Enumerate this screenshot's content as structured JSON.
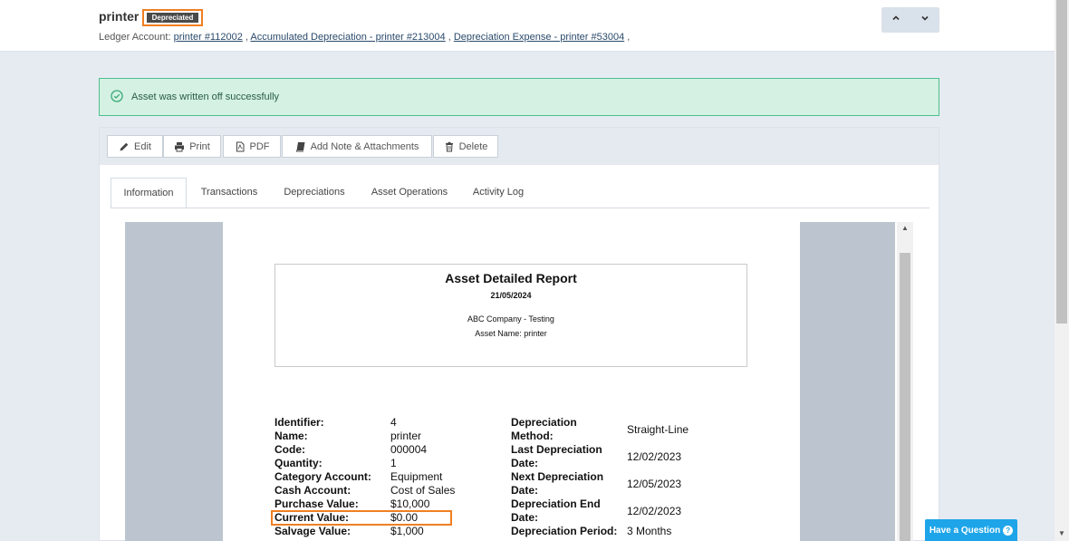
{
  "header": {
    "title": "printer",
    "badge": "Depreciated",
    "ledger_prefix": "Ledger Account:",
    "ledger_links": [
      "printer #112002",
      "Accumulated Depreciation - printer #213004",
      "Depreciation Expense - printer #53004"
    ],
    "sep": ","
  },
  "nav": {
    "up": "▲",
    "down": "▼"
  },
  "alert": {
    "message": "Asset was written off successfully"
  },
  "toolbar": {
    "edit": "Edit",
    "print": "Print",
    "pdf": "PDF",
    "note": "Add Note & Attachments",
    "delete": "Delete"
  },
  "tabs": [
    "Information",
    "Transactions",
    "Depreciations",
    "Asset Operations",
    "Activity Log"
  ],
  "report": {
    "title": "Asset Detailed Report",
    "date": "21/05/2024",
    "company": "ABC Company - Testing",
    "asset_name": "Asset Name: printer",
    "left_labels": [
      "Identifier:",
      "Name:",
      "Code:",
      "Quantity:",
      "Category Account:",
      "Cash Account:",
      "Purchase Value:",
      "Current Value:",
      "Salvage Value:"
    ],
    "left_values": [
      "4",
      "printer",
      "000004",
      "1",
      "Equipment",
      "Cost of Sales",
      "$10,000",
      "$0.00",
      "$1,000"
    ],
    "right_labels": [
      "Depreciation",
      "Method:",
      "Last Depreciation",
      "Date:",
      "Next Depreciation",
      "Date:",
      "Depreciation End",
      "Date:",
      "Depreciation Period:"
    ],
    "right_values": [
      "Straight-Line",
      "12/02/2023",
      "12/05/2023",
      "12/02/2023",
      "3 Months"
    ]
  },
  "help": {
    "label": "Have a Question",
    "q": "?"
  },
  "colors": {
    "accent": "#f07f22",
    "success_bg": "#d4f1e3",
    "help": "#1ea5e9"
  }
}
